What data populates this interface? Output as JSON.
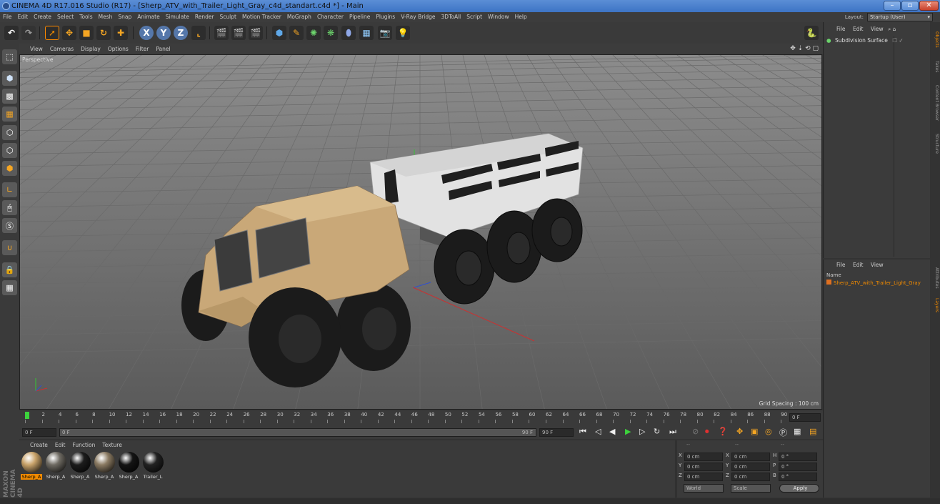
{
  "window": {
    "title": "CINEMA 4D R17.016 Studio (R17) - [Sherp_ATV_with_Trailer_Light_Gray_c4d_standart.c4d *] - Main",
    "buttons": [
      "–",
      "▫",
      "✕"
    ]
  },
  "menubar": {
    "items": [
      "File",
      "Edit",
      "Create",
      "Select",
      "Tools",
      "Mesh",
      "Snap",
      "Animate",
      "Simulate",
      "Render",
      "Sculpt",
      "Motion Tracker",
      "MoGraph",
      "Character",
      "Pipeline",
      "Plugins",
      "V-Ray Bridge",
      "3DToAll",
      "Script",
      "Window",
      "Help"
    ],
    "layout_label": "Layout:",
    "layout_value": "Startup (User)"
  },
  "toolbar": {
    "axis_x": "X",
    "axis_y": "Y",
    "axis_z": "Z"
  },
  "viewport": {
    "menu": [
      "View",
      "Cameras",
      "Display",
      "Options",
      "Filter",
      "Panel"
    ],
    "label": "Perspective",
    "grid_spacing": "Grid Spacing : 100 cm"
  },
  "timeline": {
    "ticks": [
      "0",
      "2",
      "4",
      "6",
      "8",
      "10",
      "12",
      "14",
      "16",
      "18",
      "20",
      "22",
      "24",
      "26",
      "28",
      "30",
      "32",
      "34",
      "36",
      "38",
      "40",
      "42",
      "44",
      "46",
      "48",
      "50",
      "52",
      "54",
      "56",
      "58",
      "60",
      "62",
      "64",
      "66",
      "68",
      "70",
      "72",
      "74",
      "76",
      "78",
      "80",
      "82",
      "84",
      "86",
      "88",
      "90"
    ],
    "current_frame": "0 F",
    "start_field": "0 F",
    "slider_start": "0 F",
    "slider_end": "90 F",
    "end_field": "90 F"
  },
  "materials": {
    "menu": [
      "Create",
      "Edit",
      "Function",
      "Texture"
    ],
    "items": [
      {
        "label": "Sherp_A",
        "color": "#c9a36a",
        "selected": true
      },
      {
        "label": "Sherp_A",
        "color": "#6e6a62",
        "selected": false
      },
      {
        "label": "Sherp_A",
        "color": "#1c1c1c",
        "selected": false
      },
      {
        "label": "Sherp_A",
        "color": "#8a7a62",
        "selected": false
      },
      {
        "label": "Sherp_A",
        "color": "#141414",
        "selected": false
      },
      {
        "label": "Trailer_L",
        "color": "#222222",
        "selected": false
      }
    ]
  },
  "coordinates": {
    "header": [
      "--",
      "--",
      "--"
    ],
    "rows": [
      {
        "a": "X",
        "av": "0 cm",
        "b": "X",
        "bv": "0 cm",
        "c": "H",
        "cv": "0 °"
      },
      {
        "a": "Y",
        "av": "0 cm",
        "b": "Y",
        "bv": "0 cm",
        "c": "P",
        "cv": "0 °"
      },
      {
        "a": "Z",
        "av": "0 cm",
        "b": "Z",
        "bv": "0 cm",
        "c": "B",
        "cv": "0 °"
      }
    ],
    "mode": "World",
    "scale": "Scale",
    "apply": "Apply"
  },
  "object_manager": {
    "menu": [
      "File",
      "Edit",
      "View"
    ],
    "items": [
      {
        "name": "Subdivision Surface"
      }
    ]
  },
  "attribute_manager": {
    "menu": [
      "File",
      "Edit",
      "View"
    ],
    "column": "Name",
    "layer": "Sherp_ATV_with_Trailer_Light_Gray"
  },
  "side_tabs": [
    "Objects",
    "Takes",
    "Content Browser",
    "Structure",
    "Attributes",
    "Layers"
  ],
  "brand": "MAXON CINEMA 4D",
  "colors": {
    "accent": "#f08a00",
    "selection": "#e8a640",
    "panel": "#3a3a3a"
  }
}
